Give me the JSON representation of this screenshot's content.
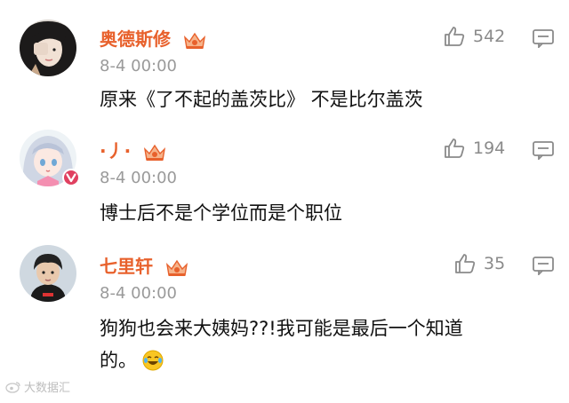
{
  "comments": [
    {
      "username": "奥德斯修",
      "time": "8-4 00:00",
      "text": "原来《了不起的盖茨比》 不是比尔盖茨",
      "likes": "542"
    },
    {
      "username": "·丿·",
      "time": "8-4 00:00",
      "text": "博士后不是个学位而是个职位",
      "likes": "194"
    },
    {
      "username": "七里轩",
      "time": "8-4 00:00",
      "text_line1": "狗狗也会来大姨妈??!我可能是最后一个知道",
      "text_line2": "的。",
      "likes": "35"
    }
  ],
  "watermark": "大数据汇",
  "colors": {
    "username": "#e8612c",
    "crown": "#e8612c",
    "verified_badge": "#e04060"
  }
}
